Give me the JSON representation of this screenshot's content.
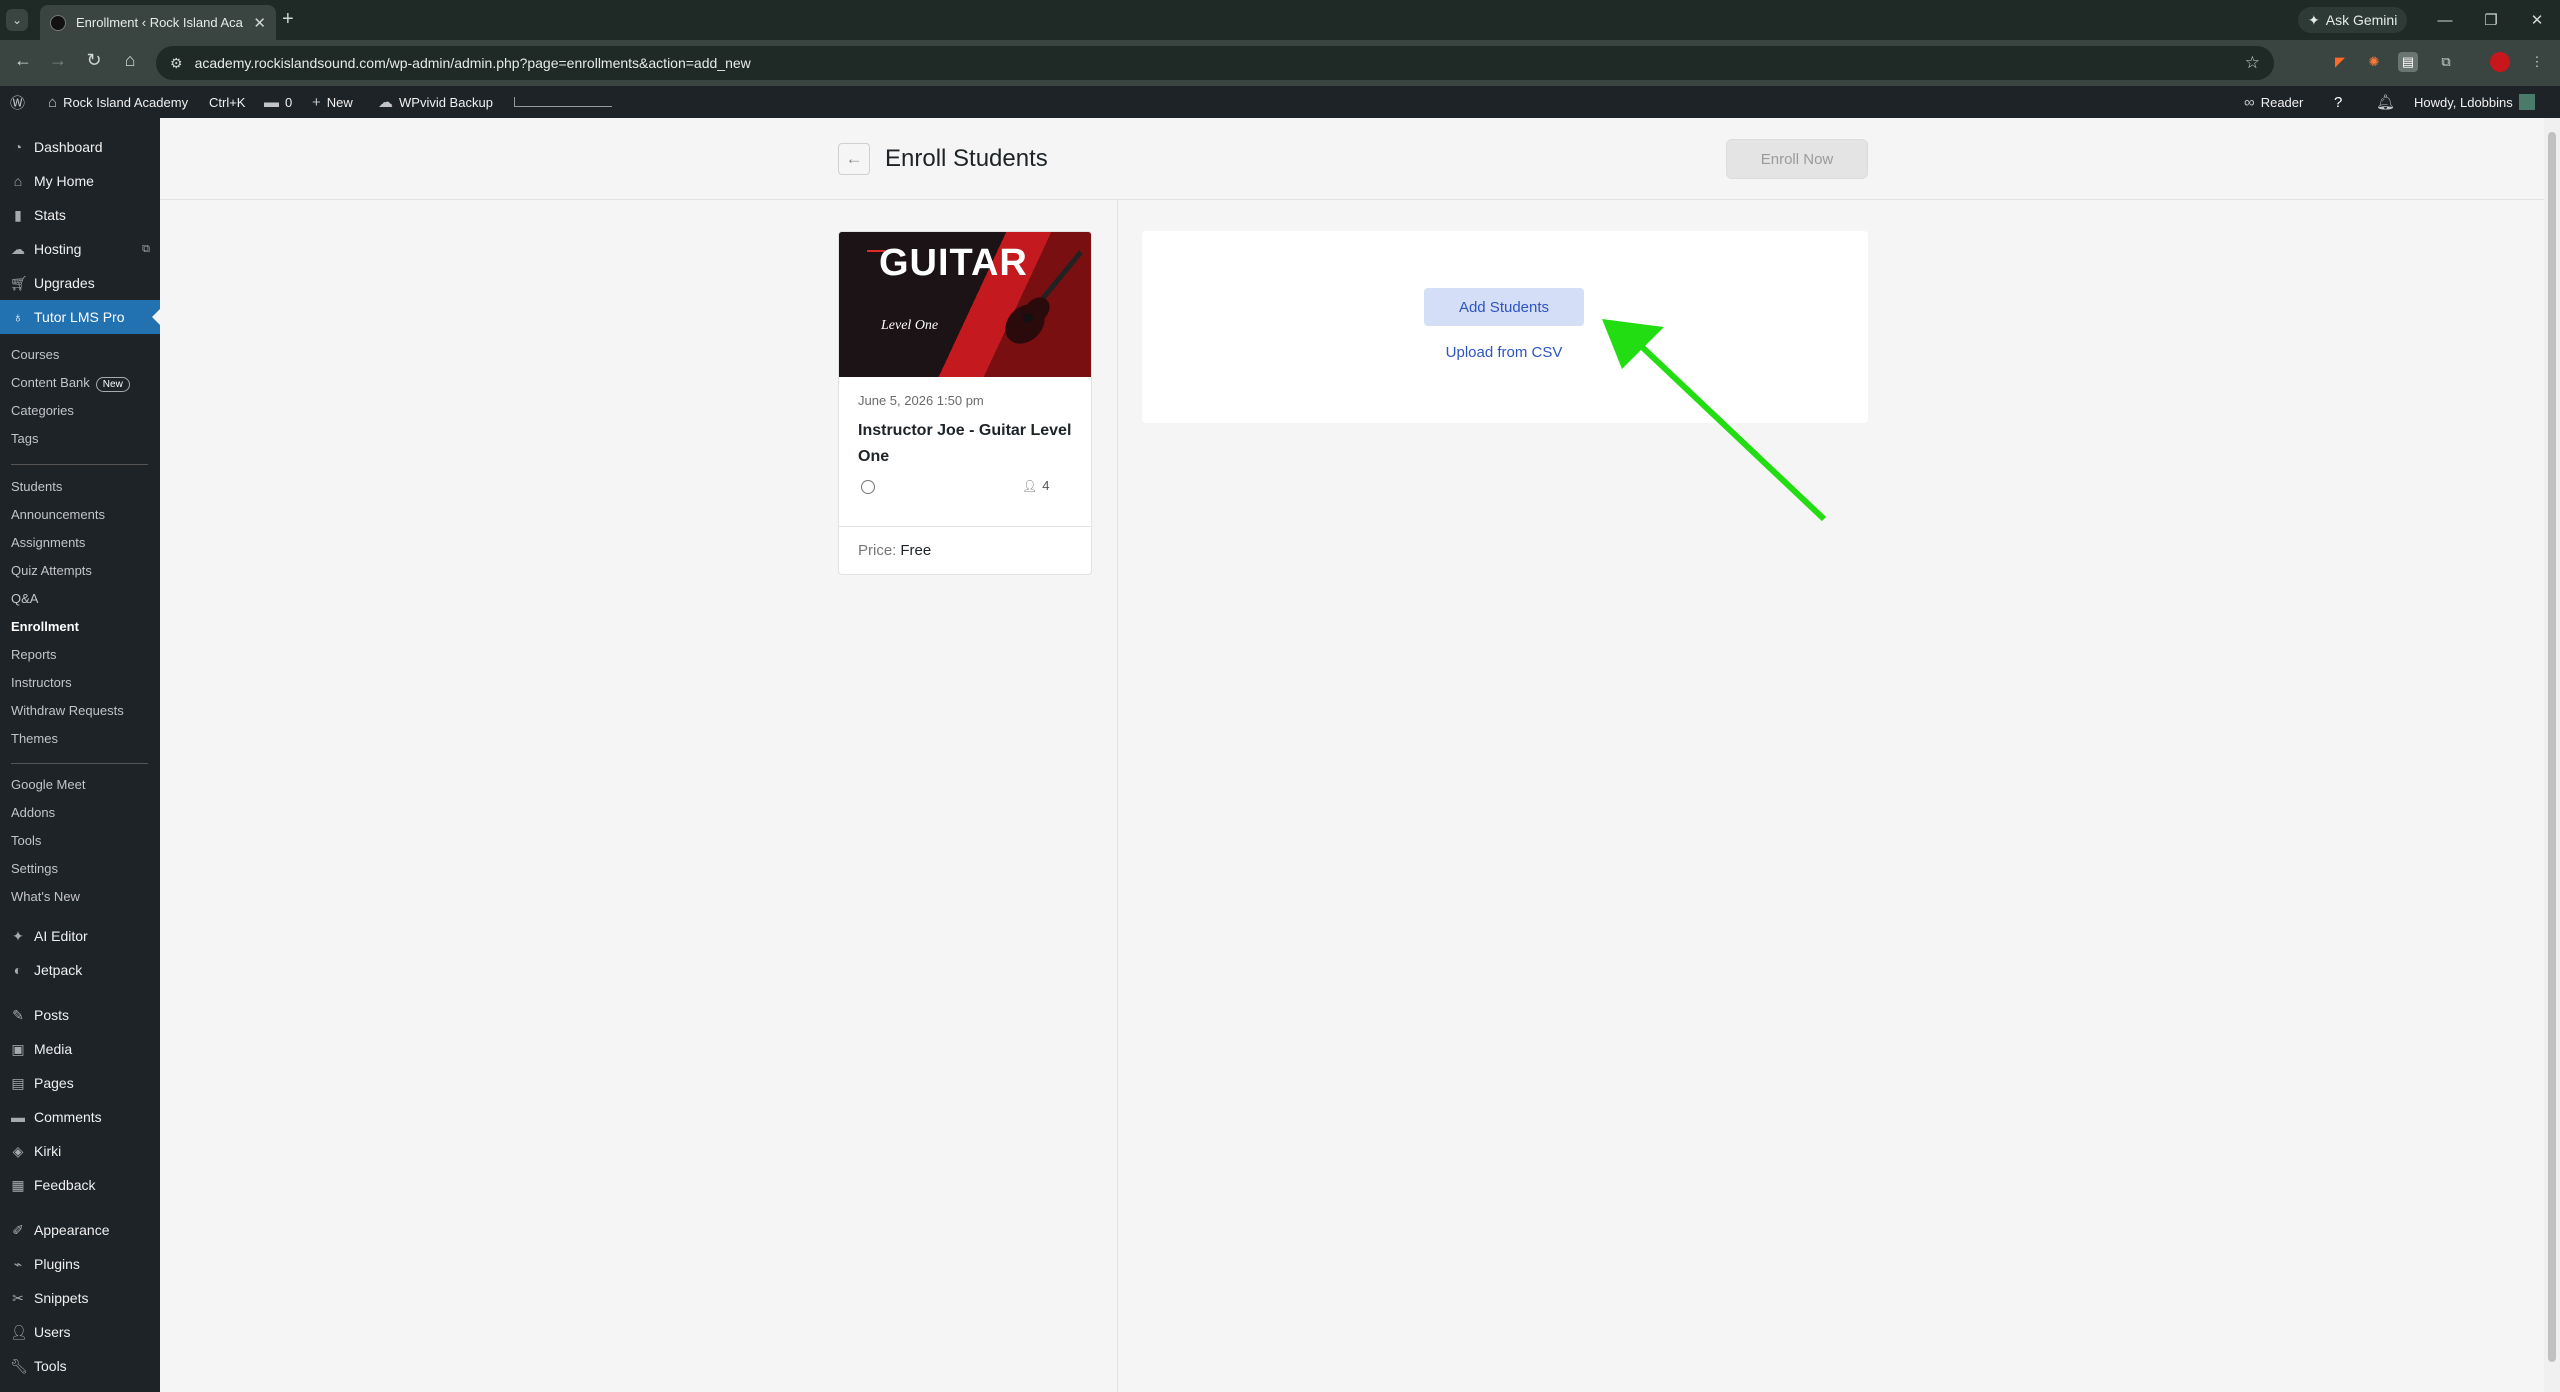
{
  "browser": {
    "tab_title": "Enrollment ‹ Rock Island Acade",
    "tab_close": "✕",
    "new_tab": "+",
    "tab_menu": "⌄",
    "ask_gemini": "Ask Gemini",
    "url": "academy.rockislandsound.com/wp-admin/admin.php?page=enrollments&action=add_new",
    "window_controls": [
      "—",
      "❐",
      "✕"
    ]
  },
  "wp_admin_bar": {
    "site_name": "Rock Island Academy",
    "shortcut": "Ctrl+K",
    "comments_count": "0",
    "new_label": "New",
    "backup_label": "WPvivid Backup",
    "reader_label": "Reader",
    "howdy": "Howdy, Ldobbins"
  },
  "sidebar": {
    "top_items": [
      {
        "label": "Dashboard",
        "icon": "dashboard-icon"
      },
      {
        "label": "My Home",
        "icon": "home-icon"
      },
      {
        "label": "Stats",
        "icon": "stats-icon"
      },
      {
        "label": "Hosting",
        "icon": "cloud-icon"
      },
      {
        "label": "Upgrades",
        "icon": "cart-icon"
      },
      {
        "label": "Tutor LMS Pro",
        "icon": "tutor-icon"
      }
    ],
    "submenu_a": [
      "Courses",
      "Content Bank",
      "Categories",
      "Tags"
    ],
    "content_bank_badge": "New",
    "submenu_b": [
      "Students",
      "Announcements",
      "Assignments",
      "Quiz Attempts",
      "Q&A",
      "Enrollment",
      "Reports",
      "Instructors",
      "Withdraw Requests",
      "Themes"
    ],
    "submenu_c": [
      "Google Meet",
      "Addons",
      "Tools",
      "Settings",
      "What's New"
    ],
    "bottom_items": [
      {
        "label": "AI Editor",
        "icon": "sparkle-icon"
      },
      {
        "label": "Jetpack",
        "icon": "jetpack-icon"
      },
      {
        "label": "Posts",
        "icon": "pin-icon"
      },
      {
        "label": "Media",
        "icon": "media-icon"
      },
      {
        "label": "Pages",
        "icon": "page-icon"
      },
      {
        "label": "Comments",
        "icon": "comment-icon"
      },
      {
        "label": "Kirki",
        "icon": "kirki-icon"
      },
      {
        "label": "Feedback",
        "icon": "feedback-icon"
      },
      {
        "label": "Appearance",
        "icon": "brush-icon"
      },
      {
        "label": "Plugins",
        "icon": "plug-icon"
      },
      {
        "label": "Snippets",
        "icon": "scissors-icon"
      },
      {
        "label": "Users",
        "icon": "user-icon"
      },
      {
        "label": "Tools",
        "icon": "wrench-icon"
      }
    ]
  },
  "page": {
    "title": "Enroll Students",
    "enroll_now": "Enroll Now",
    "add_students": "Add Students",
    "upload_csv": "Upload from CSV"
  },
  "course_card": {
    "thumb_title": "GUITAR",
    "thumb_subtitle": "Level One",
    "date": "June 5, 2026 1:50 pm",
    "name": "Instructor Joe - Guitar Level One",
    "students": "4",
    "price_label": "Price:",
    "price_value": "Free"
  },
  "colors": {
    "admin_bg": "#1d2327",
    "active_menu": "#2271b1",
    "button_bg": "#d5def7",
    "link": "#2d55c2",
    "annotation_arrow": "#22dd11"
  }
}
